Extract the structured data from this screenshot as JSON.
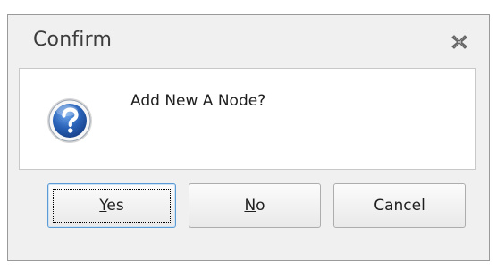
{
  "dialog": {
    "title": "Confirm",
    "message": "Add New A Node?"
  },
  "buttons": {
    "yes": {
      "mnemonic": "Y",
      "rest": "es"
    },
    "no": {
      "mnemonic": "N",
      "rest": "o"
    },
    "cancel": {
      "label": "Cancel"
    }
  },
  "icons": {
    "close": "close-icon",
    "question": "question-icon"
  },
  "colors": {
    "dialog_bg": "#f0f0f0",
    "content_bg": "#ffffff",
    "icon_blue": "#2a63b8",
    "default_button_border": "#5a9bd5"
  }
}
